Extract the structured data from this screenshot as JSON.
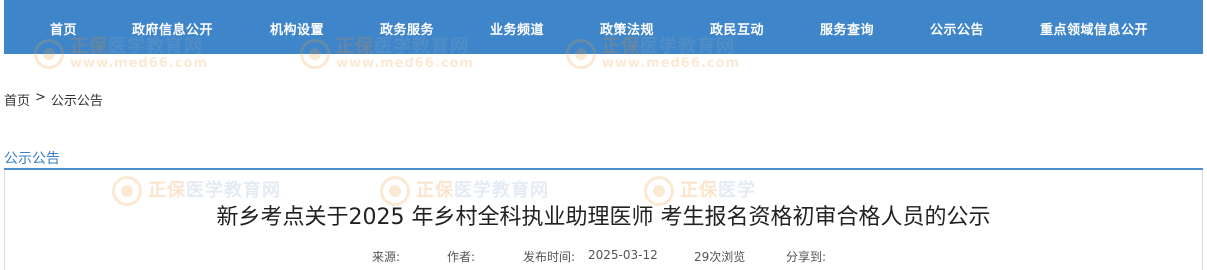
{
  "nav": {
    "items": [
      "首页",
      "政府信息公开",
      "机构设置",
      "政务服务",
      "业务频道",
      "政策法规",
      "政民互动",
      "服务查询",
      "公示公告",
      "重点领域信息公开"
    ]
  },
  "watermark": {
    "brand": "正保",
    "name": "医学教育网",
    "url": "www.med66.com",
    "partial_name": "医学"
  },
  "breadcrumb": {
    "home": "首页",
    "separator": ">",
    "current": "公示公告"
  },
  "section": {
    "title": "公示公告"
  },
  "article": {
    "title": "新乡考点关于2025 年乡村全科执业助理医师 考生报名资格初审合格人员的公示",
    "source_label": "来源:",
    "author_label": "作者:",
    "date_label": "发布时间:",
    "date": "2025-03-12",
    "views": "29次浏览",
    "share_label": "分享到:"
  },
  "colors": {
    "nav_bg": "#3f85c9",
    "accent": "#3a7cc4"
  }
}
